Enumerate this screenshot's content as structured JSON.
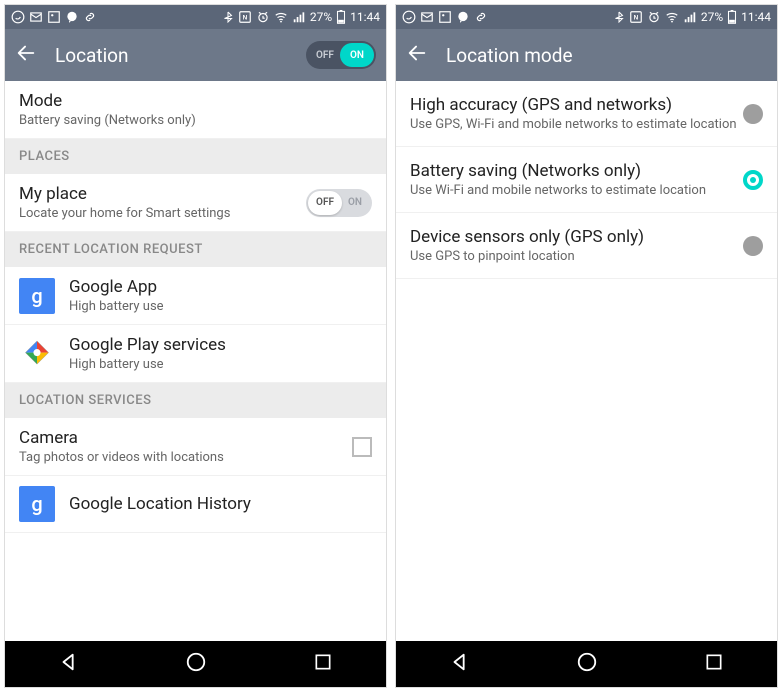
{
  "statusbar": {
    "battery_pct": "27%",
    "time": "11:44"
  },
  "left": {
    "title": "Location",
    "toggle": {
      "off_label": "OFF",
      "on_label": "ON",
      "state": "on"
    },
    "mode": {
      "title": "Mode",
      "sub": "Battery saving (Networks only)"
    },
    "section_places": "PLACES",
    "myplace": {
      "title": "My place",
      "sub": "Locate your home for Smart settings",
      "toggle": {
        "off_label": "OFF",
        "on_label": "ON",
        "state": "off"
      }
    },
    "section_recent": "RECENT LOCATION REQUEST",
    "recent": [
      {
        "title": "Google App",
        "sub": "High battery use",
        "icon": "google"
      },
      {
        "title": "Google Play services",
        "sub": "High battery use",
        "icon": "play"
      }
    ],
    "section_services": "LOCATION SERVICES",
    "services": [
      {
        "title": "Camera",
        "sub": "Tag photos or videos with locations",
        "control": "checkbox",
        "checked": false
      },
      {
        "title": "Google Location History",
        "sub": "",
        "icon": "google"
      }
    ]
  },
  "right": {
    "title": "Location mode",
    "options": [
      {
        "title": "High accuracy (GPS and networks)",
        "sub": "Use GPS, Wi-Fi and mobile networks to estimate location",
        "selected": false
      },
      {
        "title": "Battery saving (Networks only)",
        "sub": "Use Wi-Fi and mobile networks to estimate location",
        "selected": true
      },
      {
        "title": "Device sensors only (GPS only)",
        "sub": "Use GPS to pinpoint location",
        "selected": false
      }
    ]
  }
}
